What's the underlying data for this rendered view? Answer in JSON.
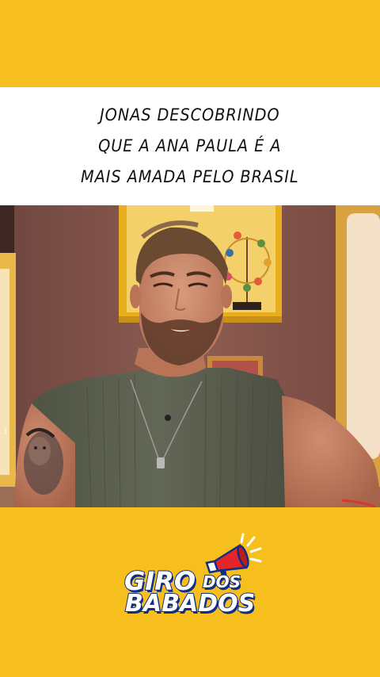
{
  "caption": {
    "lines": [
      "JONAS DESCOBRINDO",
      "QUE A ANA PAULA É A",
      "MAIS AMADA PELO BRASIL"
    ]
  },
  "video": {
    "corner_mark": "3"
  },
  "logo": {
    "word_1": "GIRO",
    "word_2": "DOS",
    "word_3": "BABADOS",
    "icon": "megaphone-icon"
  },
  "colors": {
    "background": "#F6BF1E",
    "caption_bg": "#FFFFFF",
    "logo_outline": "#0F2F86",
    "megaphone_red": "#E4262B"
  }
}
